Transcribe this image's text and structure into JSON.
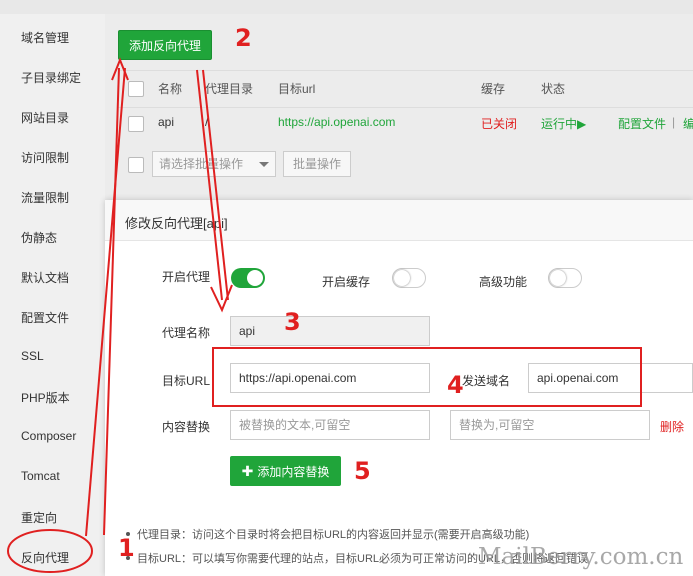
{
  "sidebar": {
    "items": [
      "域名管理",
      "子目录绑定",
      "网站目录",
      "访问限制",
      "流量限制",
      "伪静态",
      "默认文档",
      "配置文件",
      "SSL",
      "PHP版本",
      "Composer",
      "Tomcat",
      "重定向",
      "反向代理"
    ]
  },
  "toolbar": {
    "add_label": "添加反向代理"
  },
  "table": {
    "headers": [
      "名称",
      "代理目录",
      "目标url",
      "缓存",
      "状态"
    ],
    "row": {
      "name": "api",
      "dir": "/",
      "url": "https://api.openai.com",
      "cache": "已关闭",
      "status": "运行中▶",
      "action_config": "配置文件",
      "action_sep": "|",
      "action_more": "编"
    },
    "batch_placeholder": "请选择批量操作",
    "batch_button": "批量操作"
  },
  "dialog": {
    "title": "修改反向代理[api]",
    "proxy_on_label": "开启代理",
    "cache_label": "开启缓存",
    "advanced_label": "高级功能",
    "name_label": "代理名称",
    "name_value": "api",
    "url_label": "目标URL",
    "url_value": "https://api.openai.com",
    "send_domain_label": "发送域名",
    "send_domain_value": "api.openai.com",
    "replace_label": "内容替换",
    "replace_from_placeholder": "被替换的文本,可留空",
    "replace_to_placeholder": "替换为,可留空",
    "delete_label": "删除",
    "add_replace_label": "添加内容替换",
    "note1": "代理目录：访问这个目录时将会把目标URL的内容返回并显示(需要开启高级功能)",
    "note2": "目标URL：可以填写你需要代理的站点，目标URL必须为可正常访问的URL，否则将返回错误"
  },
  "annotations": [
    "1",
    "2",
    "3",
    "4",
    "5"
  ],
  "watermark": "MailBerry.com.cn",
  "colors": {
    "accent_green": "#20a53a",
    "annotation_red": "#e02020",
    "link_green": "#20a53a",
    "status_red": "#e02020"
  }
}
